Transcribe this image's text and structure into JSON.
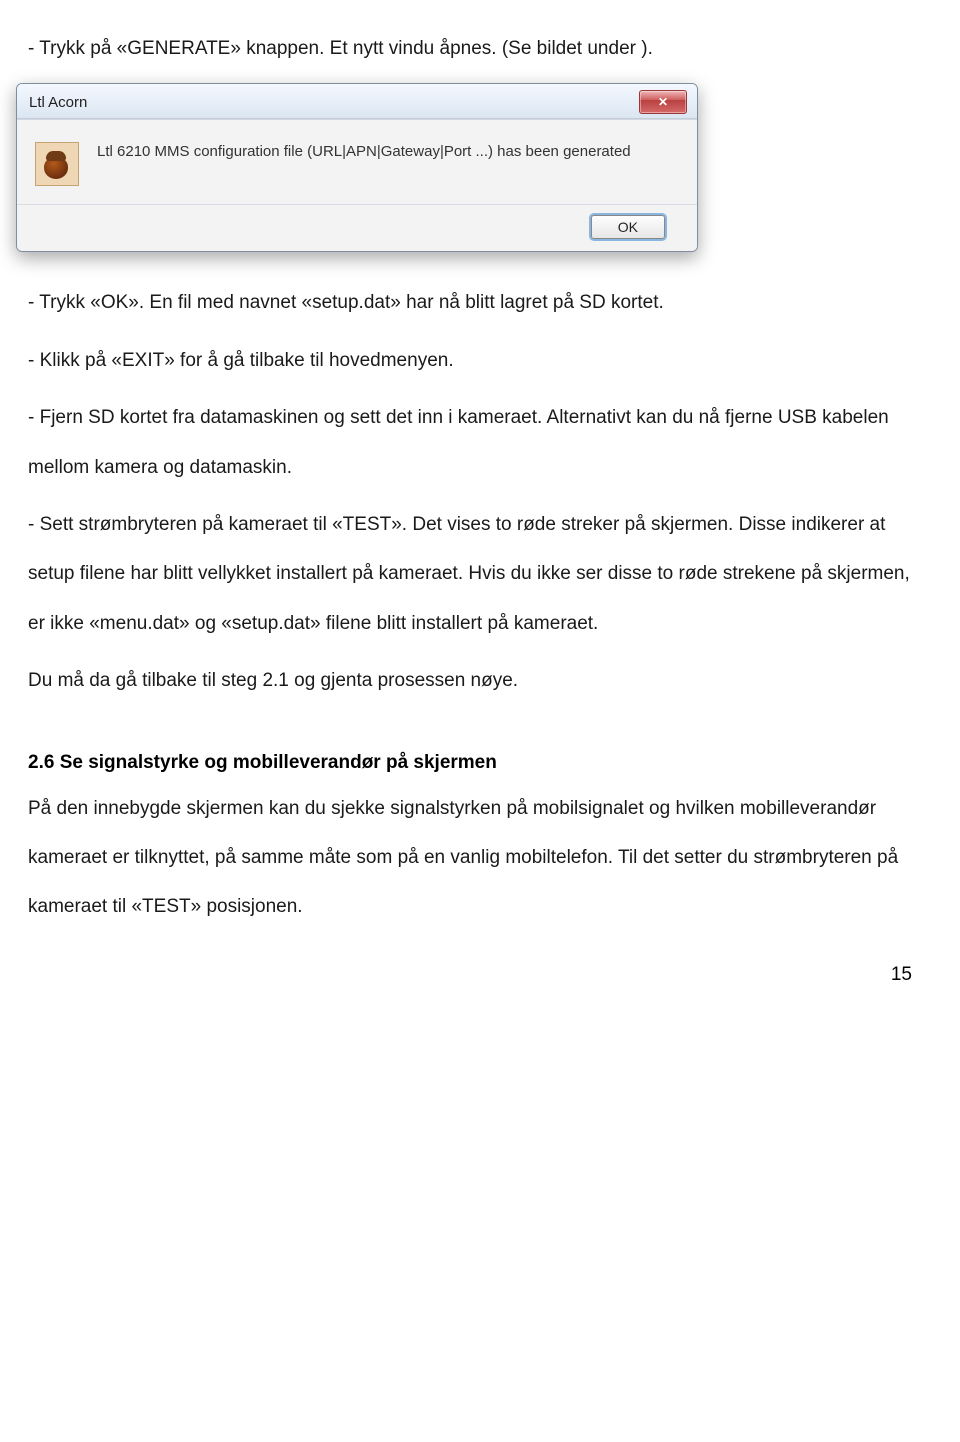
{
  "intro_line": "- Trykk på «GENERATE» knappen. Et nytt vindu åpnes. (Se bildet under ).",
  "dialog": {
    "title": "Ltl Acorn",
    "message": "Ltl 6210 MMS configuration file (URL|APN|Gateway|Port ...) has been generated",
    "ok_label": "OK",
    "close_glyph": "✕"
  },
  "p1": "- Trykk «OK». En fil med navnet «setup.dat» har nå blitt lagret på SD kortet.",
  "p2": "- Klikk på «EXIT» for å gå tilbake til hovedmenyen.",
  "p3": "- Fjern SD kortet fra datamaskinen og sett det inn i kameraet. Alternativt kan du nå fjerne USB kabelen mellom kamera og datamaskin.",
  "p4": "- Sett strømbryteren på kameraet til «TEST». Det vises to røde streker på skjermen. Disse indikerer at setup filene har blitt vellykket installert på kameraet. Hvis du ikke ser disse to røde strekene på skjermen, er ikke «menu.dat» og «setup.dat» filene blitt installert på kameraet.",
  "p5": "Du må da gå tilbake til steg 2.1 og gjenta prosessen nøye.",
  "heading_26": "2.6 Se signalstyrke og mobilleverandør på skjermen",
  "p6": "På den innebygde skjermen kan du sjekke signalstyrken på mobilsignalet og hvilken mobilleverandør kameraet er tilknyttet, på samme måte som på en vanlig mobiltelefon. Til det setter du strømbryteren på kameraet til «TEST» posisjonen.",
  "page_number": "15"
}
